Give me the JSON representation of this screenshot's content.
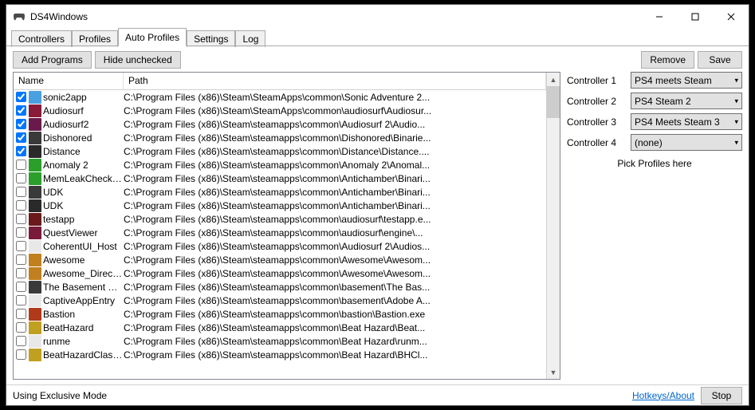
{
  "window": {
    "title": "DS4Windows"
  },
  "tabs": [
    {
      "label": "Controllers",
      "active": false
    },
    {
      "label": "Profiles",
      "active": false
    },
    {
      "label": "Auto Profiles",
      "active": true
    },
    {
      "label": "Settings",
      "active": false
    },
    {
      "label": "Log",
      "active": false
    }
  ],
  "buttons": {
    "add_programs": "Add Programs",
    "hide_unchecked": "Hide unchecked",
    "remove": "Remove",
    "save": "Save",
    "stop": "Stop"
  },
  "list": {
    "headers": {
      "name": "Name",
      "path": "Path"
    },
    "rows": [
      {
        "checked": true,
        "icon": "#4aa0e0",
        "name": "sonic2app",
        "path": "C:\\Program Files (x86)\\Steam\\SteamApps\\common\\Sonic Adventure 2..."
      },
      {
        "checked": true,
        "icon": "#8a1a3a",
        "name": "Audiosurf",
        "path": "C:\\Program Files (x86)\\Steam\\SteamApps\\common\\audiosurf\\Audiosur..."
      },
      {
        "checked": true,
        "icon": "#6a1a4a",
        "name": "Audiosurf2",
        "path": "C:\\Program Files (x86)\\Steam\\steamapps\\common\\Audiosurf 2\\Audio..."
      },
      {
        "checked": true,
        "icon": "#3a3a3a",
        "name": "Dishonored",
        "path": "C:\\Program Files (x86)\\Steam\\steamapps\\common\\Dishonored\\Binarie..."
      },
      {
        "checked": true,
        "icon": "#2a2a2a",
        "name": "Distance",
        "path": "C:\\Program Files (x86)\\Steam\\steamapps\\common\\Distance\\Distance...."
      },
      {
        "checked": false,
        "icon": "#2aa02a",
        "name": "Anomaly 2",
        "path": "C:\\Program Files (x86)\\Steam\\steamapps\\common\\Anomaly 2\\Anomal..."
      },
      {
        "checked": false,
        "icon": "#2aa02a",
        "name": "MemLeakCheckDif...",
        "path": "C:\\Program Files (x86)\\Steam\\steamapps\\common\\Antichamber\\Binari..."
      },
      {
        "checked": false,
        "icon": "#3a3a3a",
        "name": "UDK",
        "path": "C:\\Program Files (x86)\\Steam\\steamapps\\common\\Antichamber\\Binari..."
      },
      {
        "checked": false,
        "icon": "#2a2a2a",
        "name": "UDK",
        "path": "C:\\Program Files (x86)\\Steam\\steamapps\\common\\Antichamber\\Binari..."
      },
      {
        "checked": false,
        "icon": "#6a1a1a",
        "name": "testapp",
        "path": "C:\\Program Files (x86)\\Steam\\steamapps\\common\\audiosurf\\testapp.e..."
      },
      {
        "checked": false,
        "icon": "#7a1a3a",
        "name": "QuestViewer",
        "path": "C:\\Program Files (x86)\\Steam\\steamapps\\common\\audiosurf\\engine\\..."
      },
      {
        "checked": false,
        "icon": "#e8e8e8",
        "name": "CoherentUI_Host",
        "path": "C:\\Program Files (x86)\\Steam\\steamapps\\common\\Audiosurf 2\\Audios..."
      },
      {
        "checked": false,
        "icon": "#c08020",
        "name": "Awesome",
        "path": "C:\\Program Files (x86)\\Steam\\steamapps\\common\\Awesome\\Awesom..."
      },
      {
        "checked": false,
        "icon": "#c08020",
        "name": "Awesome_DirectT...",
        "path": "C:\\Program Files (x86)\\Steam\\steamapps\\common\\Awesome\\Awesom..."
      },
      {
        "checked": false,
        "icon": "#3a3a3a",
        "name": "The Basement Coll...",
        "path": "C:\\Program Files (x86)\\Steam\\steamapps\\common\\basement\\The Bas..."
      },
      {
        "checked": false,
        "icon": "#e8e8e8",
        "name": "CaptiveAppEntry",
        "path": "C:\\Program Files (x86)\\Steam\\steamapps\\common\\basement\\Adobe A..."
      },
      {
        "checked": false,
        "icon": "#b03a1a",
        "name": "Bastion",
        "path": "C:\\Program Files (x86)\\Steam\\steamapps\\common\\bastion\\Bastion.exe"
      },
      {
        "checked": false,
        "icon": "#c0a020",
        "name": "BeatHazard",
        "path": "C:\\Program Files (x86)\\Steam\\steamapps\\common\\Beat Hazard\\Beat..."
      },
      {
        "checked": false,
        "icon": "#e8e8e8",
        "name": "runme",
        "path": "C:\\Program Files (x86)\\Steam\\steamapps\\common\\Beat Hazard\\runm..."
      },
      {
        "checked": false,
        "icon": "#c0a020",
        "name": "BeatHazardClassic",
        "path": "C:\\Program Files (x86)\\Steam\\steamapps\\common\\Beat Hazard\\BHCl..."
      }
    ]
  },
  "controllers": [
    {
      "label": "Controller 1",
      "value": "PS4 meets Steam"
    },
    {
      "label": "Controller 2",
      "value": "PS4 Steam 2"
    },
    {
      "label": "Controller 3",
      "value": "PS4 Meets Steam 3"
    },
    {
      "label": "Controller 4",
      "value": "(none)"
    }
  ],
  "hint": "Pick Profiles here",
  "status": {
    "text": "Using Exclusive Mode",
    "link": "Hotkeys/About"
  }
}
